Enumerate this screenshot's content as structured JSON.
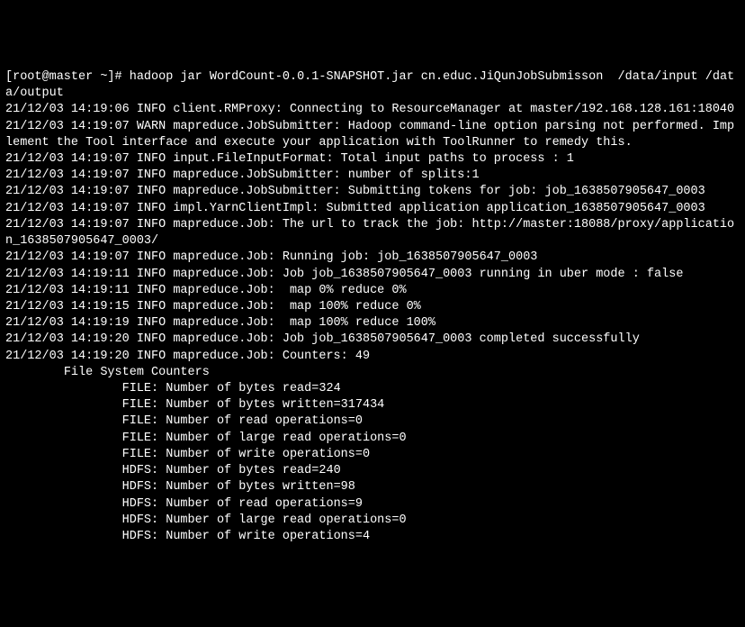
{
  "prompt": "[root@master ~]# ",
  "command": "hadoop jar WordCount-0.0.1-SNAPSHOT.jar cn.educ.JiQunJobSubmisson  /data/input /data/output",
  "lines": [
    "21/12/03 14:19:06 INFO client.RMProxy: Connecting to ResourceManager at master/192.168.128.161:18040",
    "21/12/03 14:19:07 WARN mapreduce.JobSubmitter: Hadoop command-line option parsing not performed. Implement the Tool interface and execute your application with ToolRunner to remedy this.",
    "21/12/03 14:19:07 INFO input.FileInputFormat: Total input paths to process : 1",
    "21/12/03 14:19:07 INFO mapreduce.JobSubmitter: number of splits:1",
    "21/12/03 14:19:07 INFO mapreduce.JobSubmitter: Submitting tokens for job: job_1638507905647_0003",
    "21/12/03 14:19:07 INFO impl.YarnClientImpl: Submitted application application_1638507905647_0003",
    "21/12/03 14:19:07 INFO mapreduce.Job: The url to track the job: http://master:18088/proxy/application_1638507905647_0003/",
    "21/12/03 14:19:07 INFO mapreduce.Job: Running job: job_1638507905647_0003",
    "21/12/03 14:19:11 INFO mapreduce.Job: Job job_1638507905647_0003 running in uber mode : false",
    "21/12/03 14:19:11 INFO mapreduce.Job:  map 0% reduce 0%",
    "21/12/03 14:19:15 INFO mapreduce.Job:  map 100% reduce 0%",
    "21/12/03 14:19:19 INFO mapreduce.Job:  map 100% reduce 100%",
    "21/12/03 14:19:20 INFO mapreduce.Job: Job job_1638507905647_0003 completed successfully",
    "21/12/03 14:19:20 INFO mapreduce.Job: Counters: 49",
    "        File System Counters",
    "                FILE: Number of bytes read=324",
    "                FILE: Number of bytes written=317434",
    "                FILE: Number of read operations=0",
    "                FILE: Number of large read operations=0",
    "                FILE: Number of write operations=0",
    "                HDFS: Number of bytes read=240",
    "                HDFS: Number of bytes written=98",
    "                HDFS: Number of read operations=9",
    "                HDFS: Number of large read operations=0",
    "                HDFS: Number of write operations=4"
  ]
}
